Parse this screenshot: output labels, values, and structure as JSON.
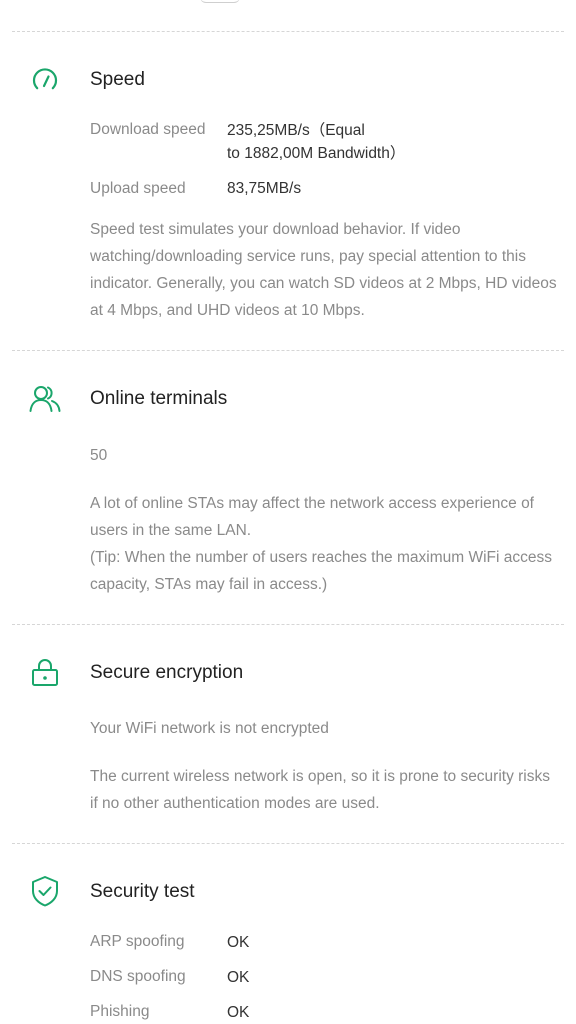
{
  "colors": {
    "accent": "#1aa66b",
    "title": "#222222",
    "label": "#8a8a8a",
    "value": "#333333",
    "divider": "#d6d6d6"
  },
  "speed": {
    "icon": "speedometer-icon",
    "title": "Speed",
    "download_label": "Download speed",
    "download_value_line1": "235,25MB/s（Equal",
    "download_value_line2": "to 1882,00M Bandwidth）",
    "upload_label": "Upload speed",
    "upload_value": "83,75MB/s",
    "description": "Speed test simulates your download behavior. If video watching/downloading service runs, pay special attention to this indicator. Generally, you can watch SD videos at 2 Mbps, HD videos at 4 Mbps, and UHD videos at 10 Mbps."
  },
  "terminals": {
    "icon": "users-icon",
    "title": "Online terminals",
    "count": "50",
    "description_line1": "A lot of online STAs may affect the network access experience of users in the same LAN.",
    "description_line2": "(Tip: When the number of users reaches the maximum WiFi access capacity, STAs may fail in access.)"
  },
  "encryption": {
    "icon": "lock-icon",
    "title": "Secure encryption",
    "status": "Your WiFi network is not encrypted",
    "description": "The current wireless network is open, so it is prone to security risks if no other authentication modes are used."
  },
  "security": {
    "icon": "shield-check-icon",
    "title": "Security test",
    "rows": [
      {
        "label": "ARP spoofing",
        "value": "OK"
      },
      {
        "label": "DNS spoofing",
        "value": "OK"
      },
      {
        "label": "Phishing",
        "value": "OK"
      }
    ]
  }
}
